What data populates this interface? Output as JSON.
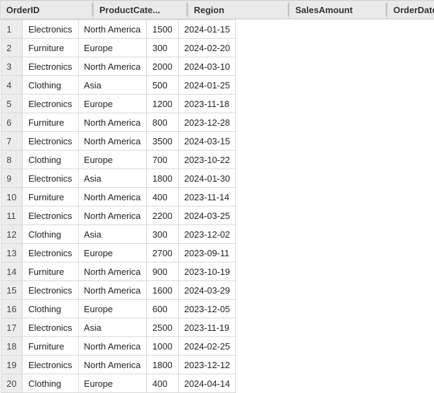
{
  "table": {
    "columns": [
      {
        "key": "OrderID",
        "label": "OrderID"
      },
      {
        "key": "ProductCategory",
        "label": "ProductCate..."
      },
      {
        "key": "Region",
        "label": "Region"
      },
      {
        "key": "SalesAmount",
        "label": "SalesAmount"
      },
      {
        "key": "OrderDate",
        "label": "OrderDate"
      }
    ],
    "rows": [
      {
        "OrderID": "1",
        "ProductCategory": "Electronics",
        "Region": "North America",
        "SalesAmount": "1500",
        "OrderDate": "2024-01-15"
      },
      {
        "OrderID": "2",
        "ProductCategory": "Furniture",
        "Region": "Europe",
        "SalesAmount": "300",
        "OrderDate": "2024-02-20"
      },
      {
        "OrderID": "3",
        "ProductCategory": "Electronics",
        "Region": "North America",
        "SalesAmount": "2000",
        "OrderDate": "2024-03-10"
      },
      {
        "OrderID": "4",
        "ProductCategory": "Clothing",
        "Region": "Asia",
        "SalesAmount": "500",
        "OrderDate": "2024-01-25"
      },
      {
        "OrderID": "5",
        "ProductCategory": "Electronics",
        "Region": "Europe",
        "SalesAmount": "1200",
        "OrderDate": "2023-11-18"
      },
      {
        "OrderID": "6",
        "ProductCategory": "Furniture",
        "Region": "North America",
        "SalesAmount": "800",
        "OrderDate": "2023-12-28"
      },
      {
        "OrderID": "7",
        "ProductCategory": "Electronics",
        "Region": "North America",
        "SalesAmount": "3500",
        "OrderDate": "2024-03-15"
      },
      {
        "OrderID": "8",
        "ProductCategory": "Clothing",
        "Region": "Europe",
        "SalesAmount": "700",
        "OrderDate": "2023-10-22"
      },
      {
        "OrderID": "9",
        "ProductCategory": "Electronics",
        "Region": "Asia",
        "SalesAmount": "1800",
        "OrderDate": "2024-01-30"
      },
      {
        "OrderID": "10",
        "ProductCategory": "Furniture",
        "Region": "North America",
        "SalesAmount": "400",
        "OrderDate": "2023-11-14"
      },
      {
        "OrderID": "11",
        "ProductCategory": "Electronics",
        "Region": "North America",
        "SalesAmount": "2200",
        "OrderDate": "2024-03-25"
      },
      {
        "OrderID": "12",
        "ProductCategory": "Clothing",
        "Region": "Asia",
        "SalesAmount": "300",
        "OrderDate": "2023-12-02"
      },
      {
        "OrderID": "13",
        "ProductCategory": "Electronics",
        "Region": "Europe",
        "SalesAmount": "2700",
        "OrderDate": "2023-09-11"
      },
      {
        "OrderID": "14",
        "ProductCategory": "Furniture",
        "Region": "North America",
        "SalesAmount": "900",
        "OrderDate": "2023-10-19"
      },
      {
        "OrderID": "15",
        "ProductCategory": "Electronics",
        "Region": "North America",
        "SalesAmount": "1600",
        "OrderDate": "2024-03-29"
      },
      {
        "OrderID": "16",
        "ProductCategory": "Clothing",
        "Region": "Europe",
        "SalesAmount": "600",
        "OrderDate": "2023-12-05"
      },
      {
        "OrderID": "17",
        "ProductCategory": "Electronics",
        "Region": "Asia",
        "SalesAmount": "2500",
        "OrderDate": "2023-11-19"
      },
      {
        "OrderID": "18",
        "ProductCategory": "Furniture",
        "Region": "North America",
        "SalesAmount": "1000",
        "OrderDate": "2024-02-25"
      },
      {
        "OrderID": "19",
        "ProductCategory": "Electronics",
        "Region": "North America",
        "SalesAmount": "1800",
        "OrderDate": "2023-12-12"
      },
      {
        "OrderID": "20",
        "ProductCategory": "Clothing",
        "Region": "Europe",
        "SalesAmount": "400",
        "OrderDate": "2024-04-14"
      }
    ]
  }
}
